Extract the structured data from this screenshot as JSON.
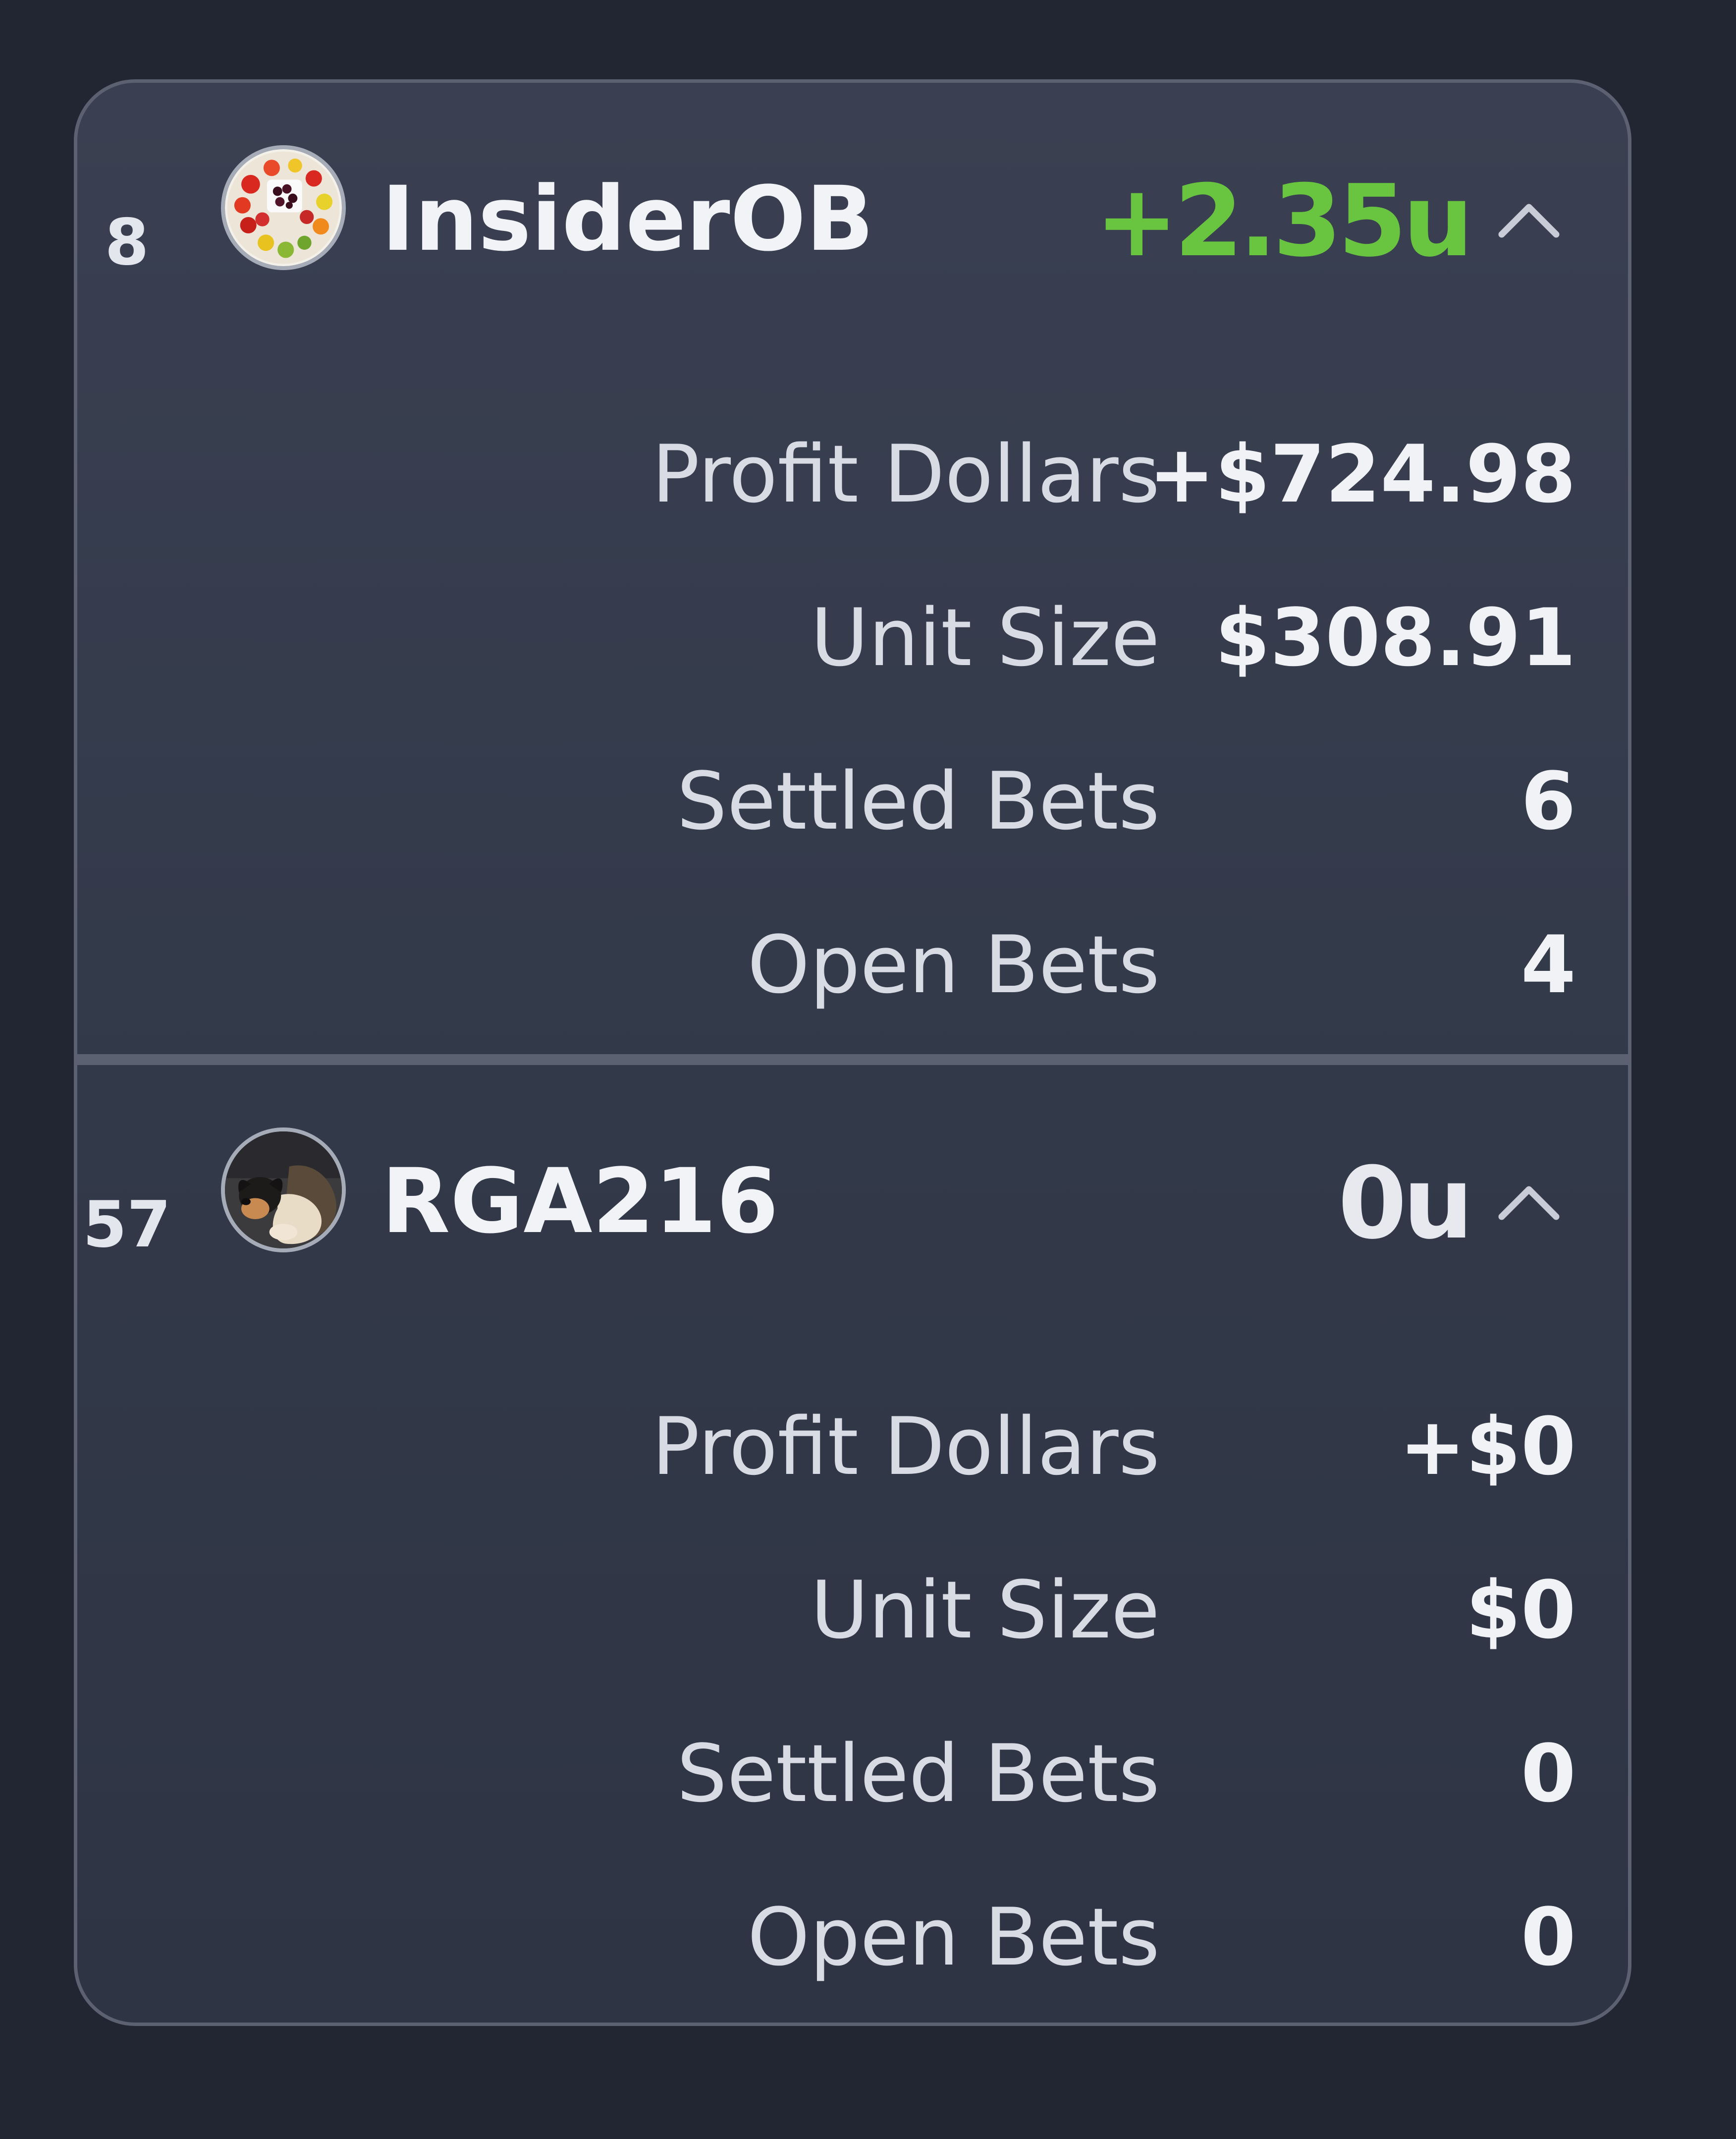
{
  "leaderboard": [
    {
      "rank": "8",
      "username": "InsiderOB",
      "units": "+2.35u",
      "units_color": "#69c43f",
      "avatar_icon": "fruit-platter-avatar",
      "toggle_icon": "chevron-up-icon",
      "stats": [
        {
          "label": "Profit Dollars",
          "value": "+$724.98"
        },
        {
          "label": "Unit Size",
          "value": "$308.91"
        },
        {
          "label": "Settled Bets",
          "value": "6"
        },
        {
          "label": "Open Bets",
          "value": "4"
        }
      ]
    },
    {
      "rank": "57",
      "username": "RGA216",
      "units": "0u",
      "units_color": "#e7e9ef",
      "avatar_icon": "sleeping-dog-avatar",
      "toggle_icon": "chevron-up-icon",
      "stats": [
        {
          "label": "Profit Dollars",
          "value": "+$0"
        },
        {
          "label": "Unit Size",
          "value": "$0"
        },
        {
          "label": "Settled Bets",
          "value": "0"
        },
        {
          "label": "Open Bets",
          "value": "0"
        }
      ]
    }
  ]
}
